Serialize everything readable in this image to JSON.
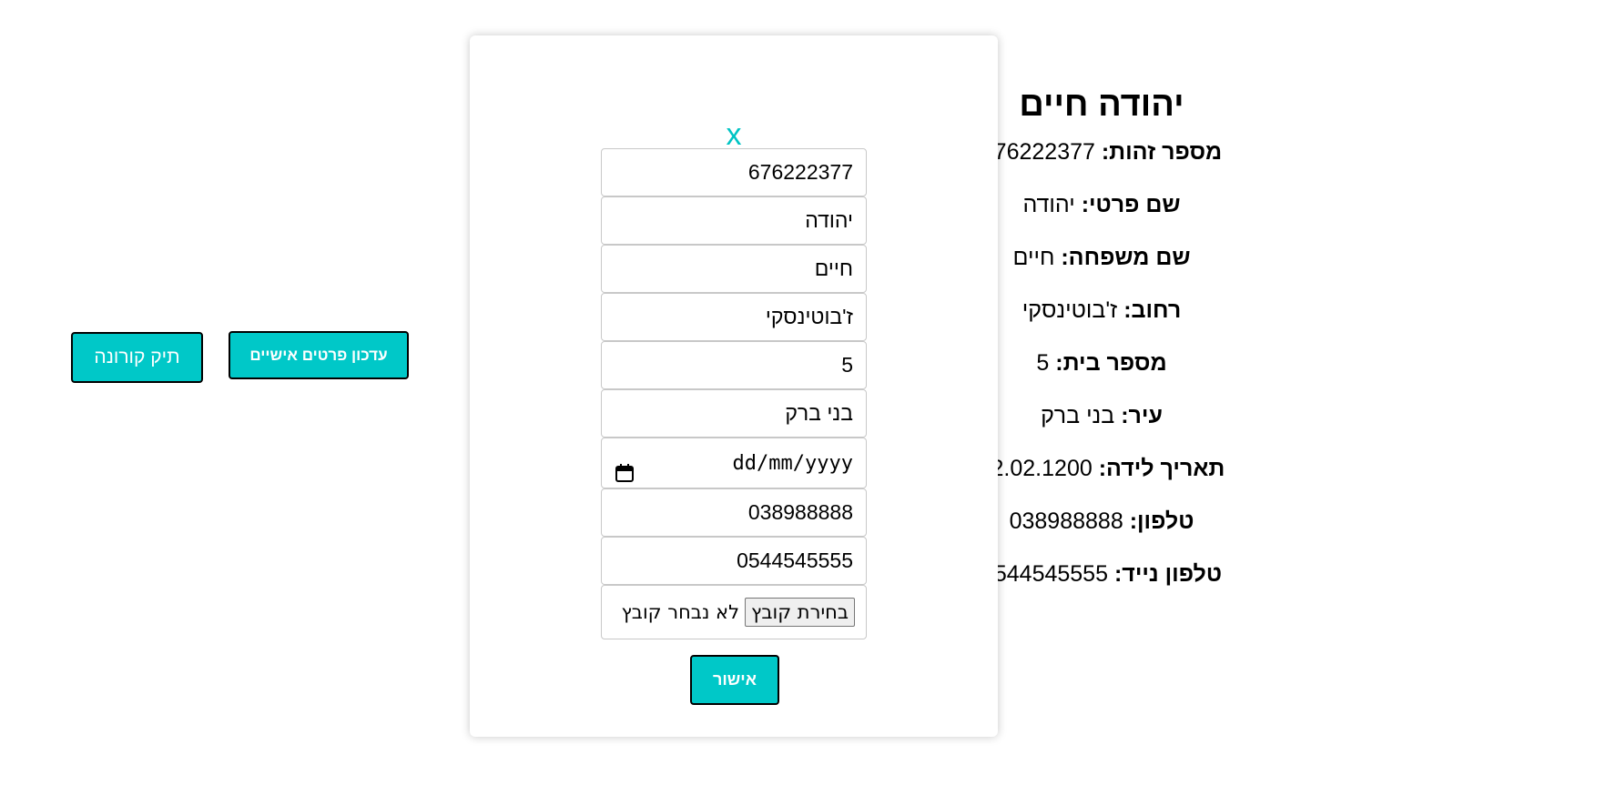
{
  "profile": {
    "name": "יהודה חיים",
    "rows": [
      {
        "label": "מספר זהות:",
        "value": "676222377"
      },
      {
        "label": "שם פרטי:",
        "value": "יהודה"
      },
      {
        "label": "שם משפחה:",
        "value": "חיים"
      },
      {
        "label": "רחוב:",
        "value": "ז'בוטינסקי"
      },
      {
        "label": "מספר בית:",
        "value": "5"
      },
      {
        "label": "עיר:",
        "value": "בני ברק"
      },
      {
        "label": "תאריך לידה:",
        "value": "12.02.1200"
      },
      {
        "label": "טלפון:",
        "value": "038988888"
      },
      {
        "label": "טלפון נייד:",
        "value": "0544545555"
      }
    ]
  },
  "buttons": {
    "corona_label": "תיק קורונה",
    "update_label": "עדכון פרטים אישיים"
  },
  "modal": {
    "close_label": "x",
    "fields": {
      "id": "676222377",
      "first_name": "יהודה",
      "last_name": "חיים",
      "street": "ז'בוטינסקי",
      "house_number": "5",
      "city": "בני ברק",
      "birth_date_placeholder": "dd/mm/yyyy",
      "phone": "038988888",
      "mobile": "0544545555"
    },
    "file": {
      "button_label": "בחירת קובץ",
      "status": "לא נבחר קובץ"
    },
    "confirm_label": "אישור"
  },
  "colors": {
    "accent": "#00c8c8",
    "close": "#00c4c4"
  },
  "icons": {
    "date_picker": "calendar-icon"
  }
}
